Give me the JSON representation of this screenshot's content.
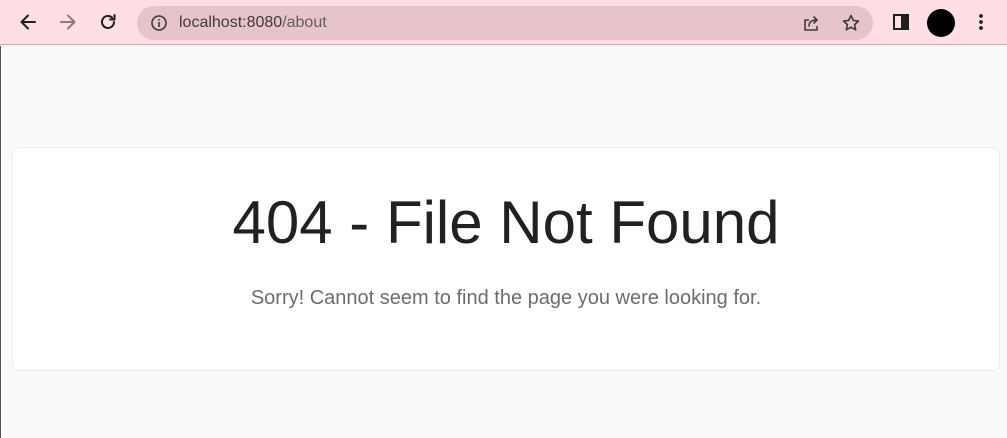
{
  "browser": {
    "url_host": "localhost:8080",
    "url_path": "/about",
    "icons": [
      "back-arrow-icon",
      "forward-arrow-icon",
      "reload-icon",
      "site-info-icon",
      "share-icon",
      "bookmark-star-icon",
      "side-panel-icon",
      "profile-avatar",
      "menu-dots-icon"
    ],
    "colors": {
      "toolbar": "#ffdfe4",
      "omnibox": "#e7c3ca",
      "avatar": "#000000"
    }
  },
  "page": {
    "title": "404 - File Not Found",
    "message": "Sorry! Cannot seem to find the page you were looking for."
  }
}
